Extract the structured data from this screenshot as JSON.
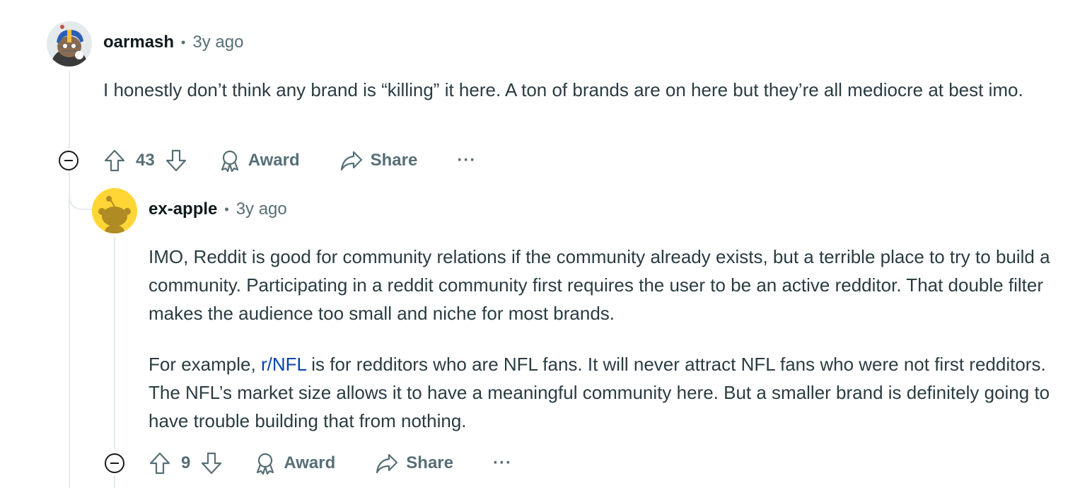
{
  "comments": [
    {
      "username": "oarmash",
      "time": "3y ago",
      "body": [
        "I honestly don’t think any brand is “killing” it here. A ton of brands are on here but they’re all mediocre at best imo."
      ],
      "score": "43",
      "award_label": "Award",
      "share_label": "Share",
      "more_label": "···"
    },
    {
      "username": "ex-apple",
      "time": "3y ago",
      "body_p1": "IMO, Reddit is good for community relations if the community already exists, but a terrible place to try to build a community. Participating in a reddit community first requires the user to be an active redditor. That double filter makes the audience too small and niche for most brands.",
      "body_p2_pre": "For example, ",
      "body_p2_link": "r/NFL",
      "body_p2_post": " is for redditors who are NFL fans. It will never attract NFL fans who were not first redditors. The NFL’s market size allows it to have a meaningful community here. But a smaller brand is definitely going to have trouble building that from nothing.",
      "score": "9",
      "award_label": "Award",
      "share_label": "Share",
      "more_label": "···"
    }
  ],
  "colors": {
    "link": "#0045ac",
    "meta": "#576f76",
    "thread": "#e5ebee",
    "avatar2_bg": "#ffd635"
  }
}
